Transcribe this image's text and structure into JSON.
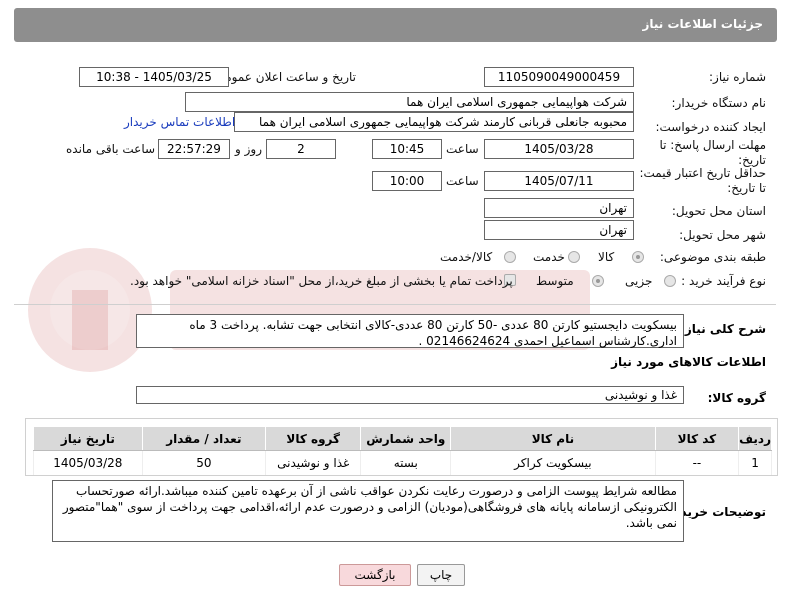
{
  "header": {
    "title": "جزئیات اطلاعات نیاز"
  },
  "fields": {
    "need_number_label": "شماره نیاز:",
    "need_number": "1105090049000459",
    "announce_label": "تاریخ و ساعت اعلان عمومی:",
    "announce_value": "1405/03/25 - 10:38",
    "buyer_label": "نام دستگاه خریدار:",
    "buyer_value": "شرکت هواپیمایی جمهوری اسلامی ایران هما",
    "creator_label": "ایجاد کننده درخواست:",
    "creator_value": "محبوبه جانعلی قربانی کارمند شرکت هواپیمایی جمهوری اسلامی ایران هما",
    "contact_link": "اطلاعات تماس خریدار",
    "deadline_label": "مهلت ارسال پاسخ: تا تاریخ:",
    "deadline_date": "1405/03/28",
    "time_label": "ساعت",
    "deadline_time": "10:45",
    "days_value": "2",
    "days_label": "روز و",
    "remaining_time": "22:57:29",
    "remaining_label": "ساعت باقی مانده",
    "min_validity_label": "حداقل تاریخ اعتبار قیمت: تا تاریخ:",
    "validity_date": "1405/07/11",
    "validity_time": "10:00",
    "province_label": "استان محل تحویل:",
    "province_value": "تهران",
    "city_label": "شهر محل تحویل:",
    "city_value": "تهران",
    "category_label": "طبقه بندی موضوعی:",
    "category_options": [
      "کالا",
      "خدمت",
      "کالا/خدمت"
    ],
    "process_label": "نوع فرآیند خرید :",
    "process_options": [
      "جزیی",
      "متوسط"
    ],
    "payment_note": "پرداخت تمام یا بخشی از مبلغ خرید،از محل \"اسناد خزانه اسلامی\" خواهد بود."
  },
  "description": {
    "label": "شرح کلی نیاز:",
    "text": "بیسکویت دایجستیو  کارتن 80 عددی -50 کارتن 80 عددی-کالای انتخابی جهت تشابه. پرداخت 3 ماه اداری.کارشناس اسماعیل احمدی 02146624624 ."
  },
  "goods": {
    "section_title": "اطلاعات کالاهای مورد نیاز",
    "group_label": "گروه کالا:",
    "group_value": "غذا و نوشیدنی",
    "columns": [
      "ردیف",
      "کد کالا",
      "نام کالا",
      "واحد شمارش",
      "گروه کالا",
      "تعداد / مقدار",
      "تاریخ نیاز"
    ],
    "rows": [
      [
        "1",
        "--",
        "بیسکویت کراکر",
        "بسته",
        "غذا و نوشیدنی",
        "50",
        "1405/03/28"
      ]
    ]
  },
  "buyer_notes": {
    "label": "توضیحات خریدار:",
    "text": "مطالعه شرایط پیوست الزامی و درصورت رعایت نکردن عواقب ناشی از آن برعهده تامین کننده میباشد.ارائه صورتحساب الکترونیکی ازسامانه پایانه های فروشگاهی(مودیان) الزامی و درصورت عدم ارائه،اقدامی جهت پرداخت از سوی \"هما\"متصور نمی باشد."
  },
  "buttons": {
    "print": "چاپ",
    "back": "بازگشت"
  },
  "colors": {
    "header": "#8e8e8e",
    "link": "#1a3cbd",
    "back_button": "#f8d9dc"
  }
}
